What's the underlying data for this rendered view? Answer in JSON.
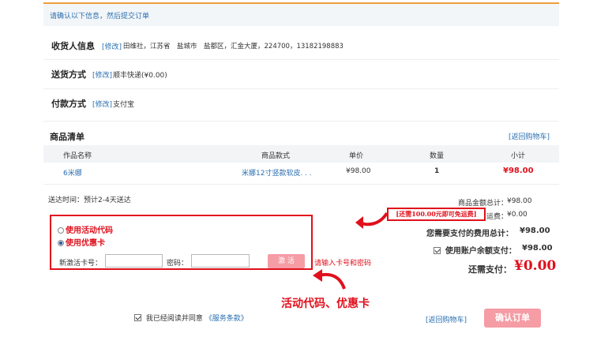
{
  "header": {
    "notice": "请确认以下信息，然后提交订单"
  },
  "receiver": {
    "title": "收货人信息",
    "edit_label": "[修改]",
    "details": "田维社，江苏省　盐城市　盐都区，汇金大厦，224700，13182198883"
  },
  "shipping": {
    "title": "送货方式",
    "edit_label": "[修改]",
    "method": "顺丰快递(¥0.00)"
  },
  "payment": {
    "title": "付款方式",
    "edit_label": "[修改]",
    "method": "支付宝"
  },
  "goods": {
    "title": "商品清单",
    "back_link": "[返回购物车]",
    "columns": [
      "作品名称",
      "商品款式",
      "单价",
      "数量",
      "小计"
    ],
    "rows": [
      {
        "name": "6米娜",
        "style": "米娜12寸竖款软皮. . .",
        "price": "¥98.00",
        "qty": "1",
        "subtotal": "¥98.00"
      }
    ]
  },
  "delivery_time": "送达时间：预计2-4天送达",
  "summary": {
    "goods_total_label": "商品金额总计：",
    "goods_total": "¥98.00",
    "free_shipping_tip": "[还需100.00元即可免运费]",
    "shipping_label": "运费：",
    "shipping_fee": "¥0.00",
    "payable_label": "您需要支付的费用总计：",
    "payable": "¥98.00",
    "balance_label": "使用账户余额支付：",
    "balance": "¥98.00",
    "due_label": "还需支付：",
    "due": "¥0.00"
  },
  "promo": {
    "option_activity": "使用活动代码",
    "option_card": "使用优惠卡",
    "selected": "使用优惠卡",
    "card_label": "新激活卡号：",
    "password_label": "密码：",
    "activate_button": "激 活",
    "hint": "请输入卡号和密码"
  },
  "annotation": "活动代码、优惠卡",
  "footer": {
    "agree_text": "我已经阅读并同意",
    "terms_link": "《服务条款》",
    "back_link": "[返回购物车]",
    "confirm_button": "确认订单"
  },
  "colors": {
    "accent_orange": "#f29c3e",
    "link_blue": "#2a6fb0",
    "alert_red": "#e0101c",
    "button_pink": "#f59ca5"
  }
}
